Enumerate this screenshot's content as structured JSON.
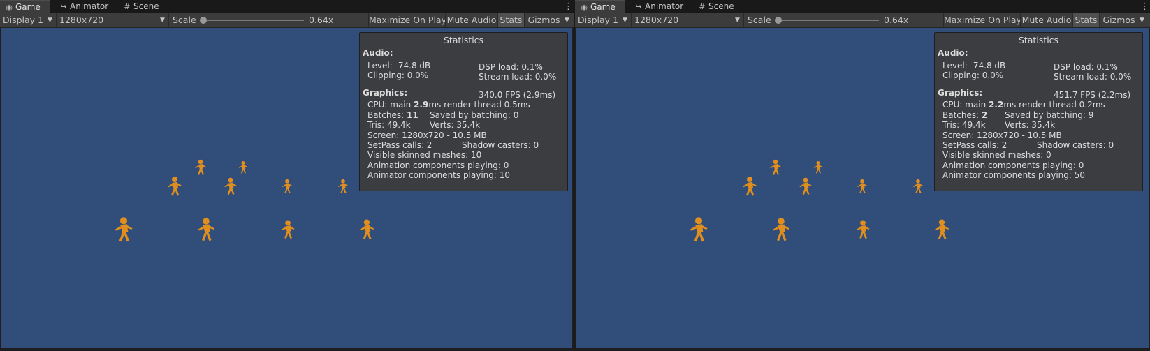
{
  "tabs": [
    {
      "label": "Game",
      "icon": "gamepad-icon"
    },
    {
      "label": "Animator",
      "icon": "animator-icon"
    },
    {
      "label": "Scene",
      "icon": "grid-icon"
    }
  ],
  "toolbar": {
    "display": "Display 1",
    "resolution": "1280x720",
    "scale_label": "Scale",
    "scale_value": "0.64x",
    "maximize": "Maximize On Play",
    "mute": "Mute Audio",
    "stats": "Stats",
    "gizmos": "Gizmos"
  },
  "colors": {
    "viewport": "#314d79",
    "figure": "#e08e1e",
    "panel": "#3c3c3c"
  },
  "panes": [
    {
      "stats": {
        "title": "Statistics",
        "audio_heading": "Audio:",
        "level": "Level: -74.8 dB",
        "clipping": "Clipping: 0.0%",
        "dsp": "DSP load: 0.1%",
        "stream": "Stream load: 0.0%",
        "graphics_heading": "Graphics:",
        "fps": "340.0 FPS (2.9ms)",
        "cpu_pre": "CPU: main ",
        "cpu_main": "2.9",
        "cpu_post": "ms  render thread 0.5ms",
        "batches_pre": "Batches: ",
        "batches": "11",
        "saved": "Saved by batching: 0",
        "tris": "Tris: 49.4k",
        "verts": "Verts: 35.4k",
        "screen": "Screen: 1280x720 - 10.5 MB",
        "setpass": "SetPass calls: 2",
        "shadow": "Shadow casters: 0",
        "skinned": "Visible skinned meshes: 10",
        "animation": "Animation components playing: 0",
        "animator": "Animator components playing: 10"
      }
    },
    {
      "stats": {
        "title": "Statistics",
        "audio_heading": "Audio:",
        "level": "Level: -74.8 dB",
        "clipping": "Clipping: 0.0%",
        "dsp": "DSP load: 0.1%",
        "stream": "Stream load: 0.0%",
        "graphics_heading": "Graphics:",
        "fps": "451.7 FPS (2.2ms)",
        "cpu_pre": "CPU: main ",
        "cpu_main": "2.2",
        "cpu_post": "ms  render thread 0.2ms",
        "batches_pre": "Batches: ",
        "batches": "2",
        "saved": "Saved by batching: 9",
        "tris": "Tris: 49.4k",
        "verts": "Verts: 35.4k",
        "screen": "Screen: 1280x720 - 10.5 MB",
        "setpass": "SetPass calls: 2",
        "shadow": "Shadow casters: 0",
        "skinned": "Visible skinned meshes: 0",
        "animation": "Animation components playing: 0",
        "animator": "Animator components playing: 50"
      }
    }
  ]
}
